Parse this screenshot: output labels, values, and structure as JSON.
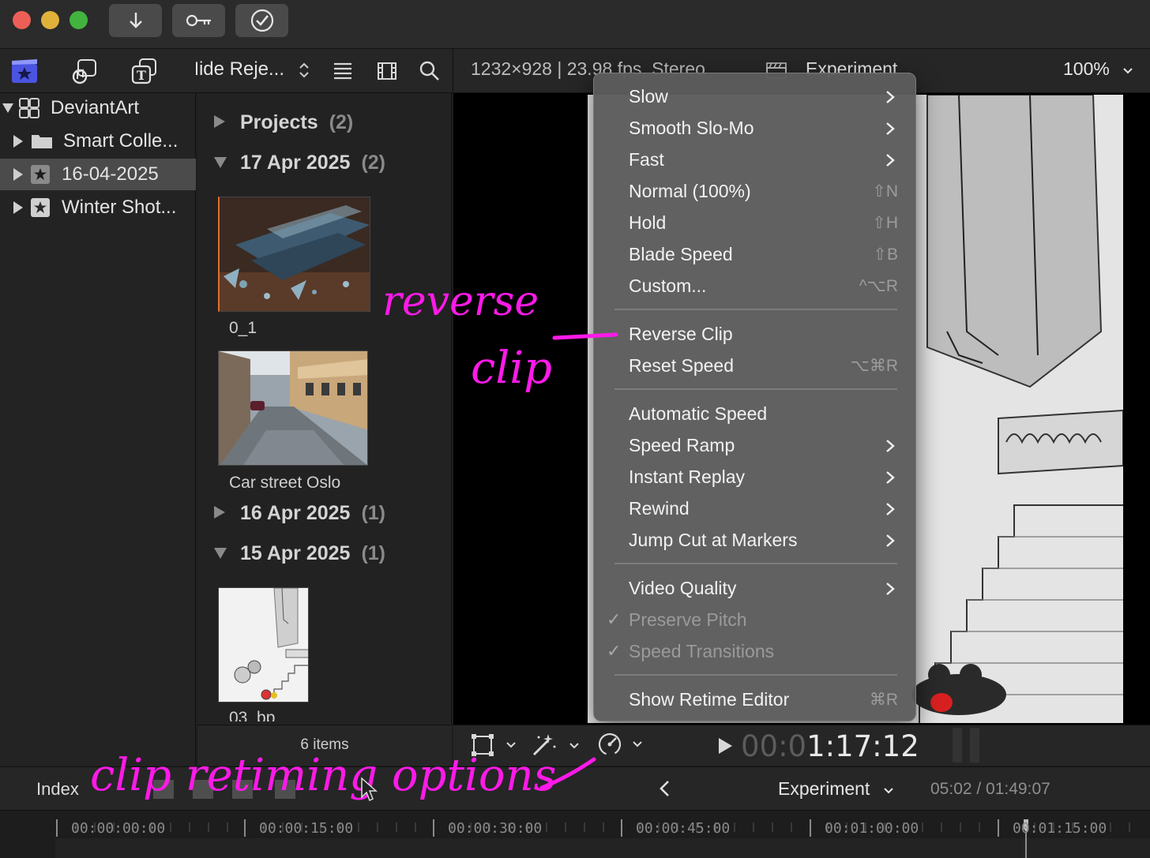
{
  "toolbar": {
    "filter_label": "Hide Reje...",
    "viewer_info": "1232×928 | 23.98 fps, Stereo",
    "project_name": "Experiment",
    "zoom": "100%"
  },
  "sidebar": {
    "library": "DeviantArt",
    "items": [
      {
        "label": "Smart Colle..."
      },
      {
        "label": "16-04-2025"
      },
      {
        "label": "Winter Shot..."
      }
    ]
  },
  "browser": {
    "groups": [
      {
        "title": "Projects",
        "count": "(2)"
      },
      {
        "title": "17 Apr 2025",
        "count": "(2)"
      },
      {
        "title": "16 Apr 2025",
        "count": "(1)"
      },
      {
        "title": "15 Apr 2025",
        "count": "(1)"
      }
    ],
    "clips": [
      {
        "label": "0_1"
      },
      {
        "label": "Car street Oslo"
      },
      {
        "label": "03_bp"
      }
    ],
    "footer": "6 items"
  },
  "speed_menu": {
    "items": [
      {
        "label": "Slow",
        "submenu": true
      },
      {
        "label": "Smooth Slo-Mo",
        "submenu": true
      },
      {
        "label": "Fast",
        "submenu": true
      },
      {
        "label": "Normal (100%)",
        "shortcut": "⇧N"
      },
      {
        "label": "Hold",
        "shortcut": "⇧H"
      },
      {
        "label": "Blade Speed",
        "shortcut": "⇧B"
      },
      {
        "label": "Custom...",
        "shortcut": "^⌥R"
      },
      {
        "label": "Reverse Clip"
      },
      {
        "label": "Reset Speed",
        "shortcut": "⌥⌘R"
      },
      {
        "label": "Automatic Speed"
      },
      {
        "label": "Speed Ramp",
        "submenu": true
      },
      {
        "label": "Instant Replay",
        "submenu": true
      },
      {
        "label": "Rewind",
        "submenu": true
      },
      {
        "label": "Jump Cut at Markers",
        "submenu": true
      },
      {
        "label": "Video Quality",
        "submenu": true
      },
      {
        "label": "Preserve Pitch",
        "checked": true,
        "disabled": true
      },
      {
        "label": "Speed Transitions",
        "checked": true,
        "disabled": true
      },
      {
        "label": "Show Retime Editor",
        "shortcut": "⌘R"
      }
    ]
  },
  "viewer": {
    "timecode_dim": "00:0",
    "timecode": "1:17:12"
  },
  "timeline": {
    "index_label": "Index",
    "project": "Experiment",
    "position": "05:02 / 01:49:07",
    "ruler": [
      "00:00:00:00",
      "00:00:15:00",
      "00:00:30:00",
      "00:00:45:00",
      "00:01:00:00",
      "00:01:15:00"
    ]
  },
  "annotations": {
    "reverse": "reverse",
    "clip": "clip",
    "retiming": "clip retiming options"
  },
  "colors": {
    "annotation": "#ff1ae8",
    "close": "#ec5f57",
    "minimize": "#e0b23a",
    "zoom": "#43b33f"
  }
}
